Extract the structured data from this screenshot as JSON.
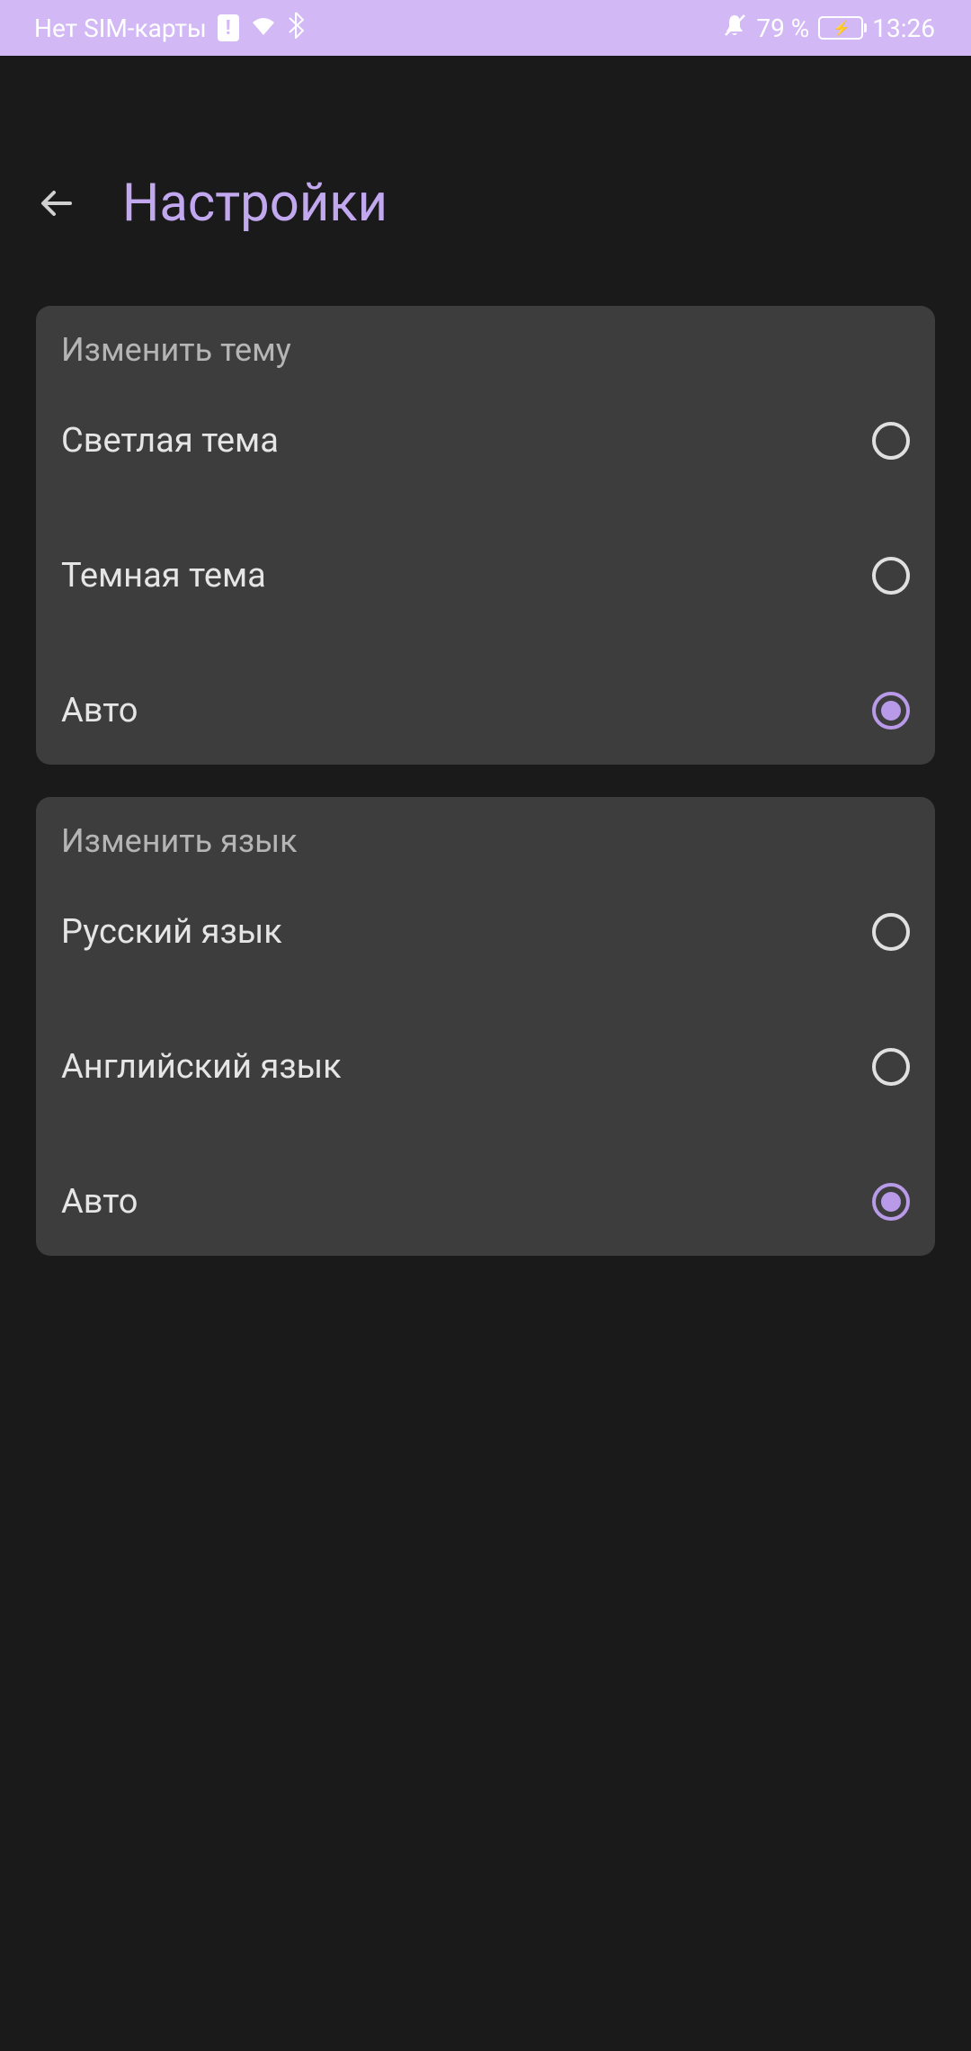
{
  "statusBar": {
    "simText": "Нет SIM-карты",
    "batteryPercent": "79 %",
    "time": "13:26"
  },
  "header": {
    "title": "Настройки"
  },
  "themeCard": {
    "title": "Изменить тему",
    "options": {
      "light": "Светлая тема",
      "dark": "Темная тема",
      "auto": "Авто"
    }
  },
  "languageCard": {
    "title": "Изменить язык",
    "options": {
      "russian": "Русский язык",
      "english": "Английский язык",
      "auto": "Авто"
    }
  }
}
